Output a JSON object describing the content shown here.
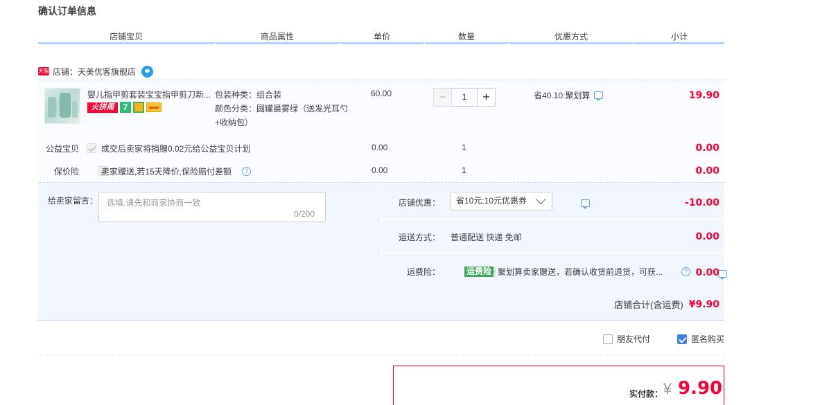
{
  "page_title": "确认订单信息",
  "columns": [
    "店铺宝贝",
    "商品属性",
    "单价",
    "数量",
    "优惠方式",
    "小计"
  ],
  "store": {
    "tmall_badge": "天猫",
    "label": "店铺：",
    "name": "天美优客旗舰店"
  },
  "item": {
    "name": "婴儿指甲剪套装宝宝指甲剪刀新...",
    "tags": {
      "hot": "火拼周",
      "seven": "7"
    },
    "prop_type_label": "包装种类：",
    "prop_type_value": "组合装",
    "prop_color_label": "颜色分类：",
    "prop_color_value": "圆罐晨雾绿（送发光耳勺+收纳包）",
    "price": "60.00",
    "quantity": "1",
    "promo": "省40.10:聚划算",
    "subtotal": "19.90"
  },
  "charity": {
    "label": "公益宝贝",
    "text": "成交后卖家将捐赠0.02元给公益宝贝计划",
    "price": "0.00",
    "qty": "1",
    "subtotal": "0.00"
  },
  "insurance": {
    "label": "保价险",
    "text": "卖家赠送,若15天降价,保险赔付差额",
    "price": "0.00",
    "qty": "1",
    "subtotal": "0.00"
  },
  "message": {
    "label": "给卖家留言：",
    "placeholder": "选填,请先和商家协商一致",
    "counter": "0/200"
  },
  "store_discount": {
    "label": "店铺优惠：",
    "value": "省10元:10元优惠券",
    "amount": "-10.00"
  },
  "shipping": {
    "label": "运送方式：",
    "value": "普通配送 快递 免邮",
    "amount": "0.00"
  },
  "freight_insurance": {
    "label": "运费险：",
    "tag": "运费险",
    "text": "聚划算卖家赠送，若确认收货前退货，可获...",
    "amount": "0.00"
  },
  "store_total": {
    "label": "店铺合计(含运费)",
    "value": "¥9.90"
  },
  "options": {
    "friend_pay": "朋友代付",
    "anonymous": "匿名购买"
  },
  "payment": {
    "label": "实付款：",
    "currency": "¥",
    "amount": "9.90"
  },
  "colors": {
    "accent_red": "#ff0036",
    "border_blue": "#b2d1ff",
    "row_bg": "#f2f6fd",
    "check_blue": "#3d7df0"
  }
}
